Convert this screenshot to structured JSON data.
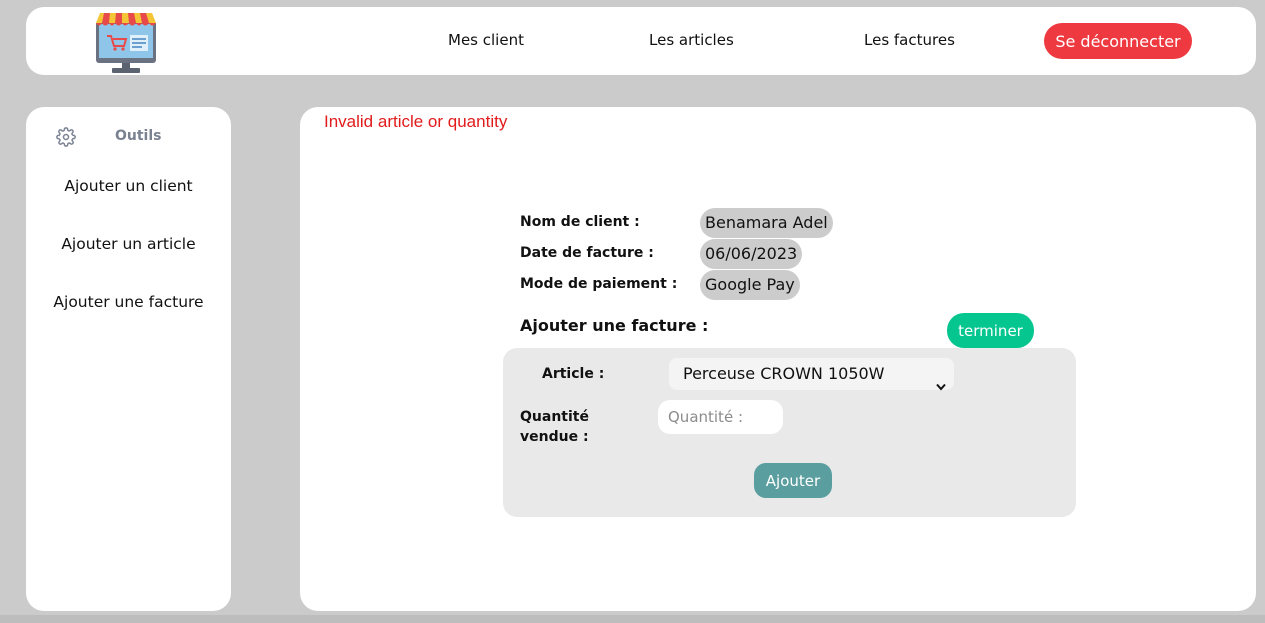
{
  "header": {
    "nav": {
      "clients": "Mes client",
      "articles": "Les articles",
      "factures": "Les factures"
    },
    "logout_label": "Se déconnecter",
    "logo_icon": "shop-monitor-logo-icon"
  },
  "sidebar": {
    "tools_label": "Outils",
    "tools_icon": "gear-icon",
    "items": [
      {
        "label": "Ajouter un client"
      },
      {
        "label": "Ajouter un article"
      },
      {
        "label": "Ajouter une facture"
      }
    ]
  },
  "main": {
    "error_message": "Invalid article or quantity",
    "fields": {
      "client_label": "Nom de client :",
      "client_value": "Benamara Adel",
      "date_label": "Date de facture :",
      "date_value": "06/06/2023",
      "payment_label": "Mode de paiement :",
      "payment_value": "Google Pay"
    },
    "section_title": "Ajouter une facture :",
    "terminer_label": "terminer",
    "form": {
      "article_label": "Article :",
      "article_selected": "Perceuse CROWN 1050W",
      "quantity_label": "Quantité vendue :",
      "quantity_placeholder": "Quantité :",
      "quantity_value": "",
      "submit_label": "Ajouter"
    }
  },
  "colors": {
    "background": "#cbcbcb",
    "logout": "#ee3940",
    "terminer": "#05c68f",
    "ajouter": "#5b9ea0",
    "error": "#e21b1b"
  }
}
